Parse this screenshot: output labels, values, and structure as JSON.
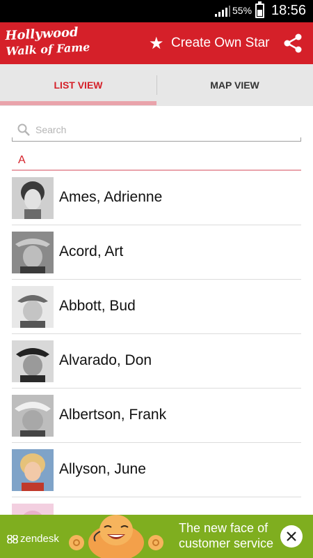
{
  "status_bar": {
    "battery_percent": "55%",
    "time": "18:56",
    "signal_icon": "signal-icon",
    "battery_icon": "battery-icon",
    "battery_level": 0.55
  },
  "app_bar": {
    "logo_line1": "Hollywood",
    "logo_line2": "Walk of Fame",
    "create_star_label": "Create Own Star",
    "star_icon": "star-icon",
    "share_icon": "share-icon",
    "color": "#d52029"
  },
  "tabs": [
    {
      "label": "LIST VIEW",
      "selected": true
    },
    {
      "label": "MAP VIEW",
      "selected": false
    }
  ],
  "search": {
    "placeholder": "Search",
    "value": ""
  },
  "section": {
    "letter": "A"
  },
  "list": {
    "items": [
      {
        "name": "Ames, Adrienne",
        "avatar": "photo-ames-adrienne"
      },
      {
        "name": "Acord, Art",
        "avatar": "photo-acord-art"
      },
      {
        "name": "Abbott, Bud",
        "avatar": "photo-abbott-bud"
      },
      {
        "name": "Alvarado, Don",
        "avatar": "photo-alvarado-don"
      },
      {
        "name": "Albertson, Frank",
        "avatar": "photo-albertson-frank"
      },
      {
        "name": "Allyson, June",
        "avatar": "photo-allyson-june"
      }
    ]
  },
  "ad": {
    "brand": "zendesk",
    "line1": "The new face of",
    "line2": "customer service",
    "close_icon": "close-icon",
    "color": "#7fae1f"
  }
}
